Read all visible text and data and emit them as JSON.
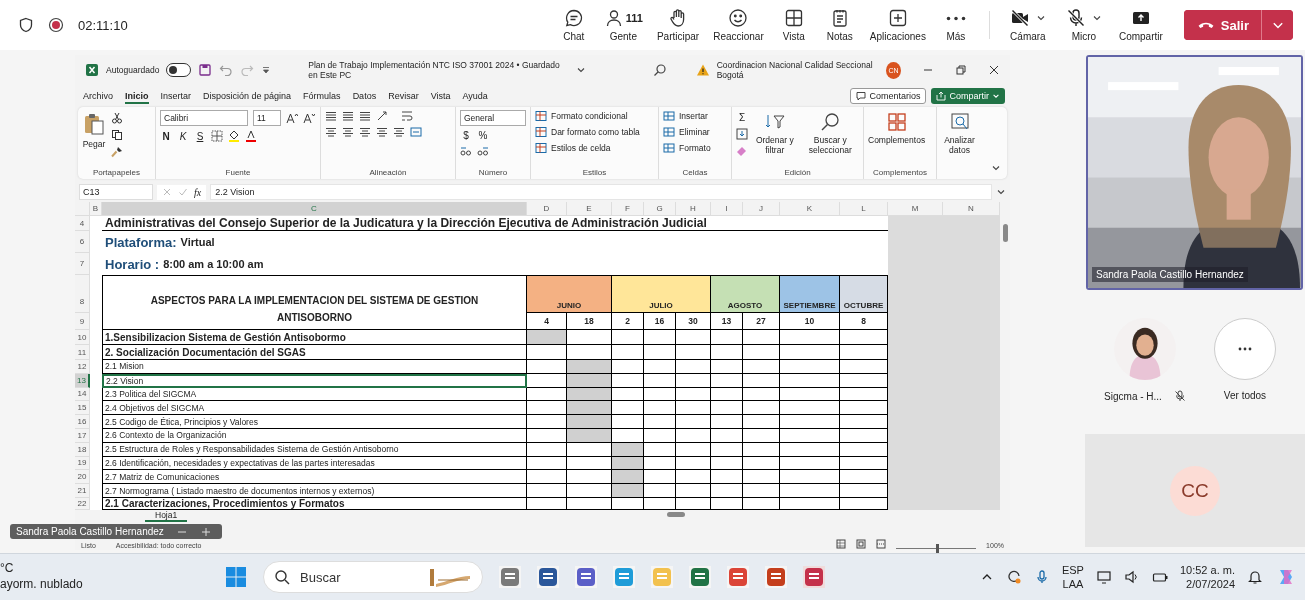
{
  "meeting": {
    "recording": true,
    "time": "02:11:10",
    "controls": [
      {
        "label": "Chat"
      },
      {
        "label": "Gente",
        "count": "111"
      },
      {
        "label": "Participar"
      },
      {
        "label": "Reaccionar"
      },
      {
        "label": "Vista"
      },
      {
        "label": "Notas"
      },
      {
        "label": "Aplicaciones"
      },
      {
        "label": "Más"
      }
    ],
    "devices": [
      {
        "label": "Cámara",
        "on": false
      },
      {
        "label": "Micro",
        "on": false
      }
    ],
    "share_button": "Compartir",
    "leave_button": "Salir"
  },
  "excel": {
    "autosave": {
      "label": "Autoguardado",
      "on": false
    },
    "title": "Plan de Trabajo Implementación NTC ISO 37001 2024 • Guardado en Este PC",
    "account": "Coordinacion Nacional Calidad Seccional Bogotá",
    "initials": "CN",
    "tabs": [
      {
        "label": "Archivo",
        "selected": false
      },
      {
        "label": "Inicio",
        "selected": true
      },
      {
        "label": "Insertar",
        "selected": false
      },
      {
        "label": "Disposición de página",
        "selected": false
      },
      {
        "label": "Fórmulas",
        "selected": false
      },
      {
        "label": "Datos",
        "selected": false
      },
      {
        "label": "Revisar",
        "selected": false
      },
      {
        "label": "Vista",
        "selected": false
      },
      {
        "label": "Ayuda",
        "selected": false
      }
    ],
    "comments_button": "Comentarios",
    "share_button": "Compartir",
    "ribbon": {
      "clipboard": {
        "paste": "Pegar",
        "label": "Portapapeles"
      },
      "font": {
        "name": "Calibri",
        "size": "11",
        "bold": "N",
        "italic": "K",
        "underline": "S",
        "label": "Fuente"
      },
      "alignment": {
        "label": "Alineación"
      },
      "number": {
        "format": "General",
        "symbols": [
          "$",
          "%"
        ],
        "label": "Número"
      },
      "styles": {
        "items": [
          "Formato condicional",
          "Dar formato como tabla",
          "Estilos de celda"
        ],
        "label": "Estilos"
      },
      "cells": {
        "items": [
          "Insertar",
          "Eliminar",
          "Formato"
        ],
        "label": "Celdas"
      },
      "editing": {
        "sum": "Σ",
        "sort": "Ordenar y filtrar",
        "find": "Buscar y seleccionar",
        "label": "Edición"
      },
      "addins": {
        "button": "Complementos",
        "label": "Complementos"
      },
      "analyze": "Analizar datos"
    },
    "formula_bar": {
      "cell": "C13",
      "fx": "fx",
      "value": "2.2 Vision"
    },
    "sheet_tab": "Hoja1",
    "zoom_slider": {
      "level": 0.5
    },
    "status": "Listo",
    "accessibility": "Accesibilidad: todo correcto",
    "zoom": "100%"
  },
  "sheet": {
    "columns": [
      "B",
      "C",
      "D",
      "E",
      "F",
      "G",
      "H",
      "I",
      "J",
      "K",
      "L",
      "M",
      "N"
    ],
    "title": {
      "row": "4",
      "text": "Administrativas del Consejo Superior de la Judicatura y la Dirección Ejecutiva de Administración Judicial"
    },
    "platform": {
      "row": "6",
      "label": "Plataforma:",
      "value": "Virtual"
    },
    "schedule": {
      "row": "7",
      "label": "Horario :",
      "value": "8:00 am a 10:00 am"
    },
    "heading": {
      "rows": [
        "8",
        "9"
      ],
      "text": "ASPECTOS PARA LA IMPLEMENTACION DEL SISTEMA DE GESTION ANTISOBORNO"
    },
    "months": [
      {
        "name": "JUNIO",
        "color": "#f4b183",
        "dates": [
          "4",
          "18"
        ]
      },
      {
        "name": "JULIO",
        "color": "#ffe699",
        "dates": [
          "2",
          "16",
          "30"
        ]
      },
      {
        "name": "AGOSTO",
        "color": "#c5e0b4",
        "dates": [
          "13",
          "27"
        ]
      },
      {
        "name": "SEPTIEMBRE",
        "color": "#9dc3e6",
        "dates": [
          "10"
        ]
      },
      {
        "name": "OCTUBRE",
        "color": "#d6dce5",
        "dates": [
          "8"
        ]
      }
    ],
    "rows": [
      {
        "row": "10",
        "kind": "heading",
        "text": "1.Sensibilizacion Sistema de Gestión Antisobormo",
        "selected": false,
        "shaded": [
          true,
          false,
          false,
          false,
          false,
          false,
          false,
          false,
          false
        ]
      },
      {
        "row": "11",
        "kind": "heading",
        "text": "2. Socialización Documentación del SGAS",
        "selected": false,
        "shaded": [
          false,
          false,
          false,
          false,
          false,
          false,
          false,
          false,
          false
        ]
      },
      {
        "row": "12",
        "kind": "item",
        "text": "2.1 Mision",
        "selected": false,
        "shaded": [
          false,
          true,
          false,
          false,
          false,
          false,
          false,
          false,
          false
        ]
      },
      {
        "row": "13",
        "kind": "item",
        "text": "2.2 Vision",
        "selected": true,
        "shaded": [
          false,
          true,
          false,
          false,
          false,
          false,
          false,
          false,
          false
        ]
      },
      {
        "row": "14",
        "kind": "item",
        "text": "2.3 Politica del SIGCMA",
        "selected": false,
        "shaded": [
          false,
          true,
          false,
          false,
          false,
          false,
          false,
          false,
          false
        ]
      },
      {
        "row": "15",
        "kind": "item",
        "text": "2.4 Objetivos del SIGCMA",
        "selected": false,
        "shaded": [
          false,
          true,
          false,
          false,
          false,
          false,
          false,
          false,
          false
        ]
      },
      {
        "row": "16",
        "kind": "item",
        "text": "2.5 Codigo de Ética, Principios y Valores",
        "selected": false,
        "shaded": [
          false,
          true,
          false,
          false,
          false,
          false,
          false,
          false,
          false
        ]
      },
      {
        "row": "17",
        "kind": "item",
        "text": "2.6 Contexto de la Organización",
        "selected": false,
        "shaded": [
          false,
          true,
          false,
          false,
          false,
          false,
          false,
          false,
          false
        ]
      },
      {
        "row": "18",
        "kind": "item",
        "text": "2.5 Estructura de Roles y Responsabilidades Sistema de Gestión Antisoborno",
        "selected": false,
        "shaded": [
          false,
          false,
          true,
          false,
          false,
          false,
          false,
          false,
          false
        ]
      },
      {
        "row": "19",
        "kind": "item",
        "text": "2.6 Identificación, necesidades y expectativas de las partes interesadas",
        "selected": false,
        "shaded": [
          false,
          false,
          true,
          false,
          false,
          false,
          false,
          false,
          false
        ]
      },
      {
        "row": "20",
        "kind": "item",
        "text": "2.7 Matriz de Comunicaciones",
        "selected": false,
        "shaded": [
          false,
          false,
          true,
          false,
          false,
          false,
          false,
          false,
          false
        ]
      },
      {
        "row": "21",
        "kind": "item",
        "text": "2.7 Normograma ( Listado maestro de documentos internos y externos)",
        "selected": false,
        "shaded": [
          false,
          false,
          true,
          false,
          false,
          false,
          false,
          false,
          false
        ]
      },
      {
        "row": "22",
        "kind": "heading",
        "text": "2.1 Caracterizaciones, Procedimientos y Formatos",
        "selected": false,
        "shaded": [
          false,
          false,
          false,
          false,
          false,
          false,
          false,
          false,
          false
        ]
      }
    ]
  },
  "presenter_tag": "Sandra Paola Castillo Hernandez",
  "side": {
    "speaker": "Sandra Paola Castillo Hernandez",
    "participants": [
      {
        "name": "Sigcma - H...",
        "muted": true
      }
    ],
    "more_label": "Ver todos",
    "initials": "CC"
  },
  "taskbar": {
    "temperature": "°C",
    "weather": "ayorm. nublado",
    "search": "Buscar",
    "language": [
      "ESP",
      "LAA"
    ],
    "time": "10:52 a. m.",
    "date": "2/07/2024"
  }
}
